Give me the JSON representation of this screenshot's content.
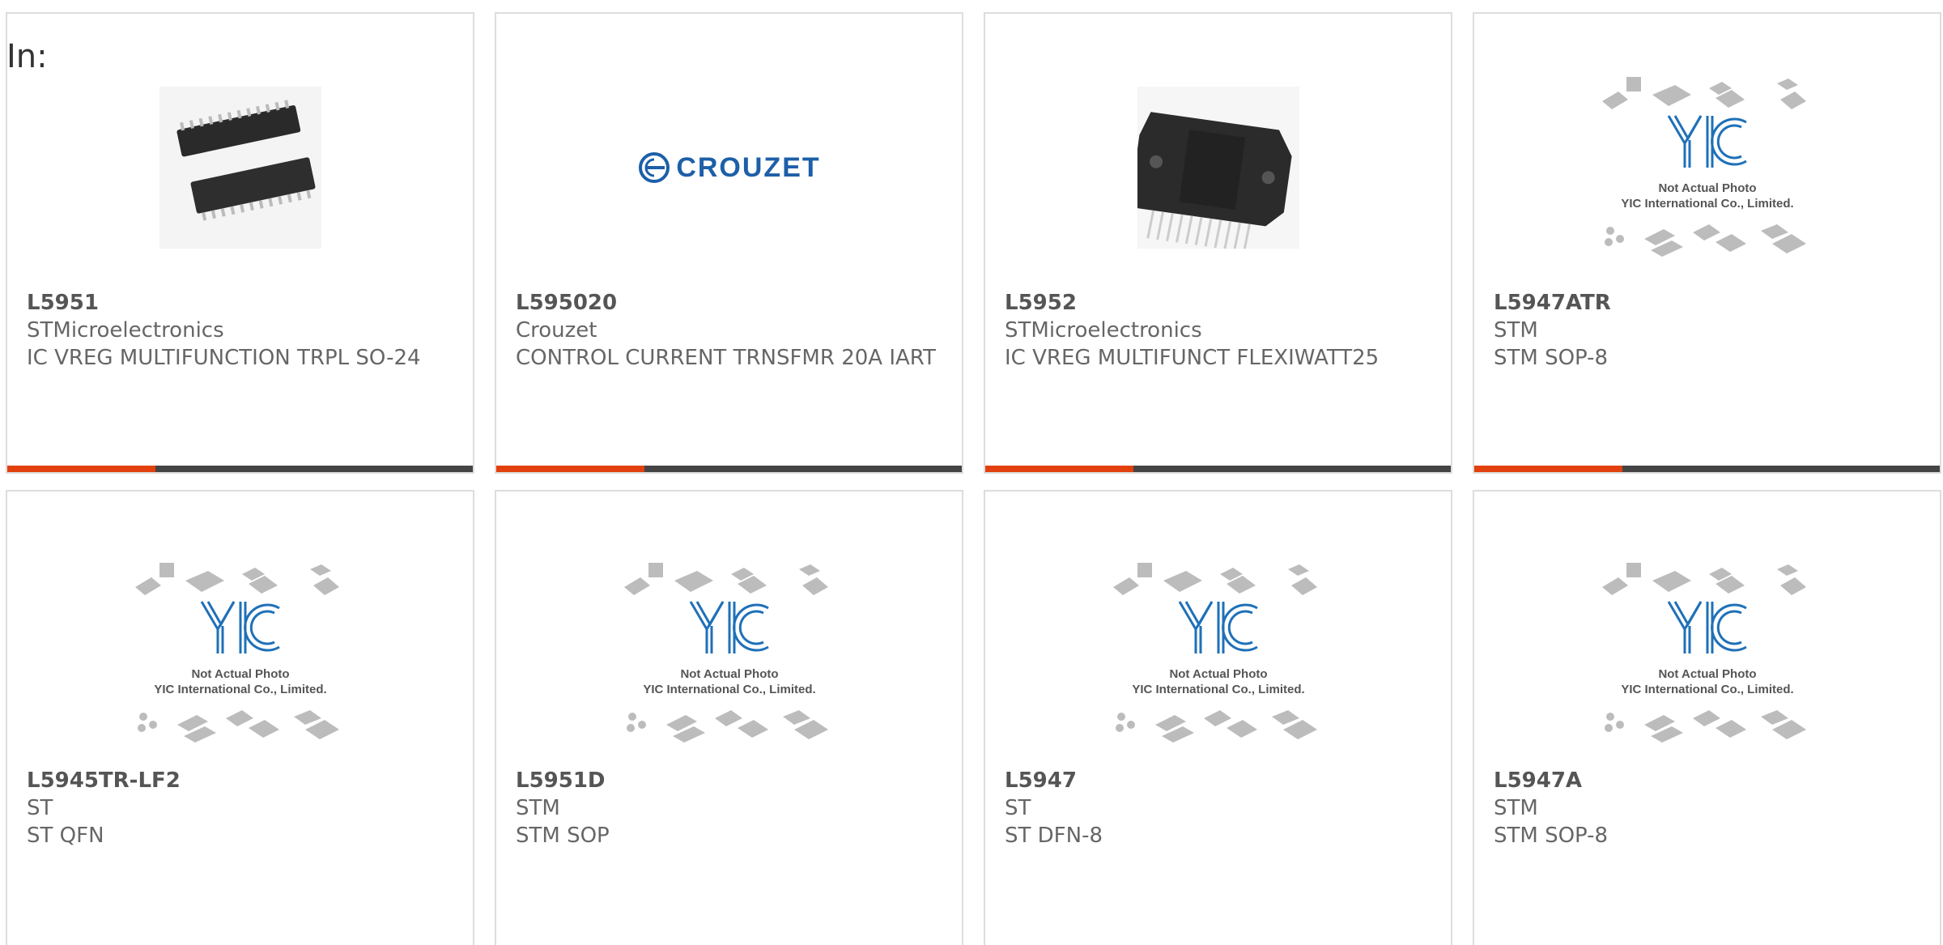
{
  "header": {
    "in_label": "In:"
  },
  "colors": {
    "accent": "#e2400d",
    "bar": "#444444",
    "border": "#dddddd",
    "yic_blue": "#1f70b8"
  },
  "placeholder": {
    "line1": "Not Actual Photo",
    "line2": "YIC International Co., Limited.",
    "logo_text": "YIC"
  },
  "crouzet_logo": {
    "text": "CROUZET"
  },
  "cards": [
    {
      "part": "L5951",
      "maker": "STMicroelectronics",
      "desc": "IC VREG MULTIFUNCTION TRPL SO-24",
      "image": "so24-chip"
    },
    {
      "part": "L595020",
      "maker": "Crouzet",
      "desc": "CONTROL CURRENT TRNSFMR 20A IART",
      "image": "crouzet-logo"
    },
    {
      "part": "L5952",
      "maker": "STMicroelectronics",
      "desc": "IC VREG MULTIFUNCT FLEXIWATT25",
      "image": "flexiwatt-chip"
    },
    {
      "part": "L5947ATR",
      "maker": "STM",
      "desc": "STM SOP-8",
      "image": "yic-placeholder"
    },
    {
      "part": "L5945TR-LF2",
      "maker": "ST",
      "desc": "ST QFN",
      "image": "yic-placeholder"
    },
    {
      "part": "L5951D",
      "maker": "STM",
      "desc": "STM SOP",
      "image": "yic-placeholder"
    },
    {
      "part": "L5947",
      "maker": "ST",
      "desc": "ST DFN-8",
      "image": "yic-placeholder"
    },
    {
      "part": "L5947A",
      "maker": "STM",
      "desc": "STM SOP-8",
      "image": "yic-placeholder"
    }
  ]
}
